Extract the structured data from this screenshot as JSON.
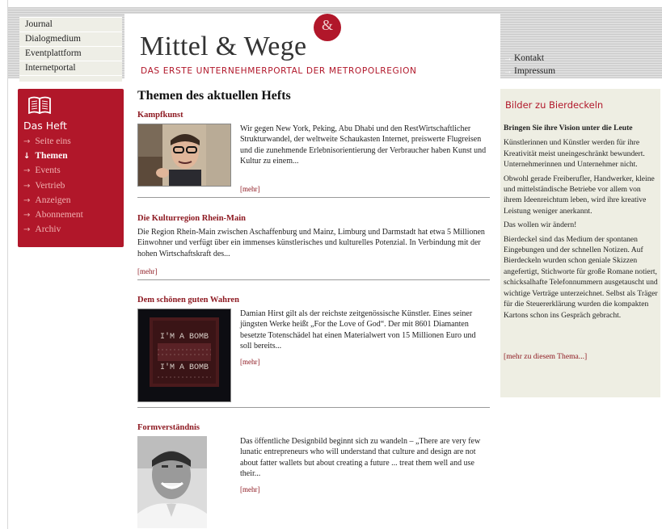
{
  "topnav": {
    "items": [
      "Journal",
      "Dialogmedium",
      "Eventplattform",
      "Internetportal"
    ]
  },
  "logo": {
    "title": "Mittel & Wege",
    "amp": "&",
    "subtitle": "DAS ERSTE UNTERNEHMERPORTAL DER METROPOLREGION"
  },
  "utilnav": {
    "items": [
      "Kontakt",
      "Impressum"
    ]
  },
  "sidebar": {
    "icon": "book-icon",
    "heading": "Das Heft",
    "items": [
      {
        "label": "Seite eins",
        "active": false
      },
      {
        "label": "Themen",
        "active": true
      },
      {
        "label": "Events",
        "active": false
      },
      {
        "label": "Vertrieb",
        "active": false
      },
      {
        "label": "Anzeigen",
        "active": false
      },
      {
        "label": "Abonnement",
        "active": false
      },
      {
        "label": "Archiv",
        "active": false
      }
    ]
  },
  "main": {
    "title": "Themen des aktuellen Hefts",
    "articles": [
      {
        "title": "Kampfkunst",
        "text": "Wir gegen New York, Peking, Abu Dhabi und den RestWirtschaftlicher Strukturwandel, der weltweite Schaukasten Internet, preiswerte Flugreisen und die zunehmende Erlebnisorientierung der Verbraucher haben Kunst und Kultur zu einem...",
        "more": "[mehr]"
      },
      {
        "title": "Die Kulturregion Rhein-Main",
        "text": "Die Region Rhein-Main zwischen Aschaffenburg und Mainz, Limburg und Darmstadt hat etwa 5 Millionen Einwohner und verfügt über ein immenses künstlerisches und kulturelles Potenzial. In Verbindung mit der hohen Wirtschaftskraft des...",
        "more": "[mehr]"
      },
      {
        "title": "Dem schönen guten Wahren",
        "text": "Damian Hirst gilt als der reichste zeitgenössische Künstler. Eines seiner jüngsten Werke heißt „For the Love of God“. Der mit 8601 Diamanten besetzte Totenschädel hat einen Materialwert von 15 Millionen Euro und soll bereits...",
        "more": "[mehr]",
        "image_text": "I'M A BOMB"
      },
      {
        "title": "Formverständnis",
        "text": "Das öffentliche Designbild beginnt sich zu wandeln – „There are very few lunatic entrepreneurs who will understand that culture and design are not about fatter wallets but about creating a future ... treat them well and use their...",
        "more": "[mehr]"
      }
    ]
  },
  "rightbox": {
    "title": "Bilder zu Bierdeckeln",
    "lead": "Bringen Sie ihre Vision unter die Leute",
    "paragraphs": [
      "Künstlerinnen und Künstler werden für ihre Kreativität meist uneingeschränkt bewundert. Unternehmerinnen und Unternehmer nicht.",
      "Obwohl gerade Freiberufler, Handwerker, kleine und mittelständische Betriebe vor allem von ihrem Ideenreichtum leben, wird ihre kreative Leistung weniger anerkannt.",
      "Das wollen wir ändern!",
      "Bierdeckel sind das Medium der spontanen Eingebungen und der schnellen Notizen. Auf Bierdeckeln wurden schon geniale Skizzen angefertigt, Stichworte für große Romane notiert, schicksalhafte Telefonnummern ausgetauscht und wichtige Verträge unterzeichnet. Selbst als Träger für die Steuererklärung wurden die kompakten Kartons schon ins Gespräch gebracht."
    ],
    "more": "[mehr zu diesem Thema...]"
  },
  "colors": {
    "brand_red": "#b1172a",
    "link_red": "#8e1a22",
    "panel_beige": "#eeeee3"
  }
}
